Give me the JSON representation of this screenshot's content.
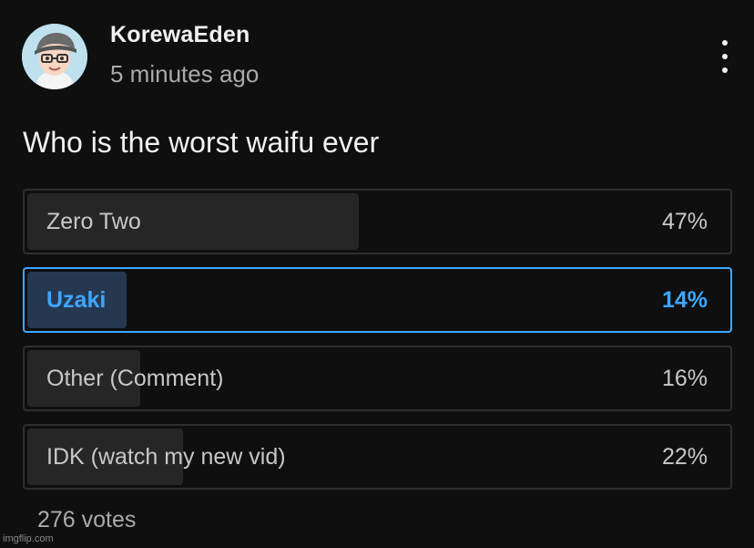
{
  "post": {
    "author": "KorewaEden",
    "timestamp": "5 minutes ago",
    "question": "Who is the worst waifu ever",
    "total_votes": "276 votes"
  },
  "poll": {
    "options": [
      {
        "label": "Zero Two",
        "percent_text": "47%",
        "percent": 47,
        "selected": false
      },
      {
        "label": "Uzaki",
        "percent_text": "14%",
        "percent": 14,
        "selected": true
      },
      {
        "label": "Other (Comment)",
        "percent_text": "16%",
        "percent": 16,
        "selected": false
      },
      {
        "label": "IDK (watch my new vid)",
        "percent_text": "22%",
        "percent": 22,
        "selected": false
      }
    ]
  },
  "icons": {
    "avatar": "avatar-icon",
    "more": "more-vertical-icon"
  },
  "colors": {
    "background": "#0f0f0f",
    "accent": "#3ea6ff",
    "selected_fill": "#263850",
    "option_fill": "#262626"
  },
  "watermark": "imgflip.com"
}
